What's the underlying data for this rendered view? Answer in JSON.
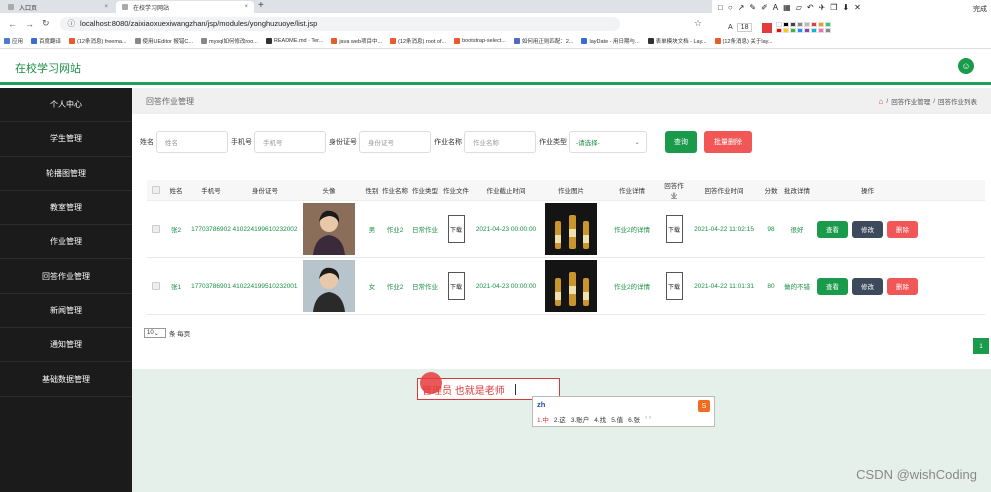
{
  "browser": {
    "tabs": [
      {
        "label": "入口页"
      },
      {
        "label": "在校学习网站"
      }
    ],
    "new_tab": "+",
    "close": "×",
    "url": "localhost:8080/zaixiaoxuexiwangzhan/jsp/modules/yonghuzuoye/list.jsp",
    "zoom_label": "18",
    "done_label": "完成",
    "bookmarks": [
      {
        "label": "应用",
        "color": "#4a7bd1"
      },
      {
        "label": "百度翻译",
        "color": "#3b6bd6"
      },
      {
        "label": "(12条消息) freema...",
        "color": "#e85c2a"
      },
      {
        "label": "使用UEditor 报错C...",
        "color": "#888888"
      },
      {
        "label": "mysql如何修改roo...",
        "color": "#888888"
      },
      {
        "label": "README.md · Ter...",
        "color": "#333333"
      },
      {
        "label": "java web项目中...",
        "color": "#e85c2a"
      },
      {
        "label": "(12条消息) root of...",
        "color": "#e85c2a"
      },
      {
        "label": "bootstrap-select...",
        "color": "#e85c2a"
      },
      {
        "label": "如何用正则匹配：2...",
        "color": "#5566cc"
      },
      {
        "label": "layDate - 用日期与...",
        "color": "#3b6bd6"
      },
      {
        "label": "表单模块文档 - Lay...",
        "color": "#333333"
      },
      {
        "label": "(12条消息) 关于lay...",
        "color": "#e85c2a"
      }
    ],
    "swatch_colors": [
      "#ffffff",
      "#000000",
      "#444444",
      "#888888",
      "#bbbbbb",
      "#e23b3b",
      "#f39c12",
      "#2ecc71",
      "#ff0000",
      "#ffcc00",
      "#3bb54a",
      "#1e90ff",
      "#8e44ad",
      "#00bcd4",
      "#ff69b4",
      "#7f8c8d"
    ]
  },
  "header": {
    "site_title": "在校学习网站",
    "avatar_icon": "user-icon"
  },
  "sidebar": {
    "items": [
      {
        "label": "个人中心"
      },
      {
        "label": "学生管理"
      },
      {
        "label": "轮播图管理"
      },
      {
        "label": "教室管理"
      },
      {
        "label": "作业管理"
      },
      {
        "label": "回答作业管理"
      },
      {
        "label": "新闻管理"
      },
      {
        "label": "通知管理"
      },
      {
        "label": "基础数据管理"
      }
    ]
  },
  "page": {
    "title": "回答作业管理",
    "breadcrumb": [
      "回答作业管理",
      "回答作业列表"
    ],
    "breadcrumb_sep": "/"
  },
  "filters": {
    "name_label": "姓名",
    "name_placeholder": "姓名",
    "phone_label": "手机号",
    "phone_placeholder": "手机号",
    "id_label": "身份证号",
    "id_placeholder": "身份证号",
    "work_label": "作业名称",
    "work_placeholder": "作业名称",
    "type_label": "作业类型",
    "type_value": "-请选择-",
    "search_button": "查询",
    "batch_delete_button": "批量删除"
  },
  "table": {
    "headers": [
      "姓名",
      "手机号",
      "身份证号",
      "头像",
      "性别",
      "作业名称",
      "作业类型",
      "作业文件",
      "作业截止时间",
      "作业图片",
      "作业详情",
      "回答作业",
      "回答作业时间",
      "分数",
      "批改详情",
      "操作"
    ],
    "download_label": "下载",
    "view_label": "查看",
    "edit_label": "修改",
    "delete_label": "删除",
    "rows": [
      {
        "name": "张2",
        "phone": "17703786902",
        "id": "410224199610232002",
        "gender": "男",
        "work": "作业2",
        "type": "日常作业",
        "deadline": "2021-04-23 00:00:00",
        "detail": "作业2的详情",
        "answer_time": "2021-04-22 11:02:15",
        "score": "98",
        "review": "很好"
      },
      {
        "name": "张1",
        "phone": "17703786901",
        "id": "410224199510232001",
        "gender": "女",
        "work": "作业2",
        "type": "日常作业",
        "deadline": "2021-04-23 00:00:00",
        "detail": "作业2的详情",
        "answer_time": "2021-04-22 11:01:31",
        "score": "80",
        "review": "做的不错"
      }
    ]
  },
  "pagination": {
    "page_size": "10",
    "page_size_suffix": "条 每页",
    "current_page": "1"
  },
  "ime": {
    "composed_text": "管理员 也就是老师",
    "input": "zh",
    "candidates": [
      "1.中",
      "2.这",
      "3.账户",
      "4.找",
      "5.值",
      "6.张"
    ],
    "arrows": "‹ ›",
    "logo": "S"
  },
  "watermark": "CSDN @wishCoding"
}
